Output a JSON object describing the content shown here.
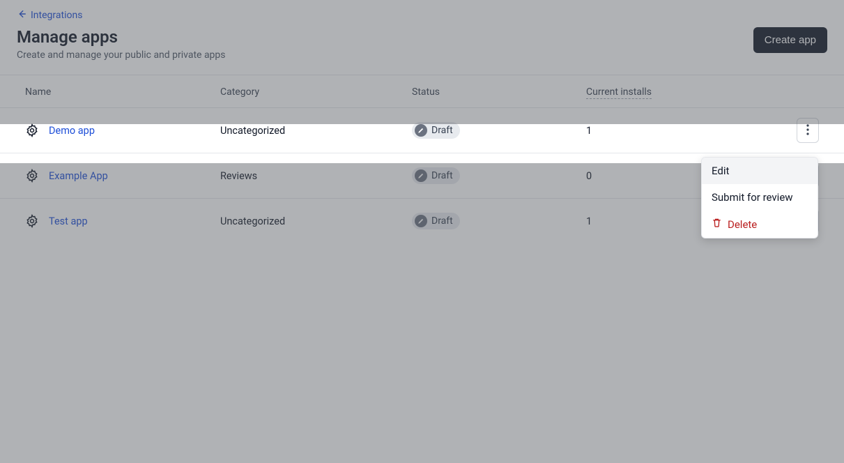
{
  "back": {
    "label": "Integrations"
  },
  "header": {
    "title": "Manage apps",
    "subtitle": "Create and manage your public and private apps",
    "create_button": "Create app"
  },
  "table": {
    "columns": {
      "name": "Name",
      "category": "Category",
      "status": "Status",
      "installs": "Current installs"
    },
    "rows": [
      {
        "name": "Demo app",
        "category": "Uncategorized",
        "status": "Draft",
        "installs": "1"
      },
      {
        "name": "Example App",
        "category": "Reviews",
        "status": "Draft",
        "installs": "0"
      },
      {
        "name": "Test app",
        "category": "Uncategorized",
        "status": "Draft",
        "installs": "1"
      }
    ]
  },
  "menu": {
    "edit": "Edit",
    "submit": "Submit for review",
    "delete": "Delete"
  }
}
